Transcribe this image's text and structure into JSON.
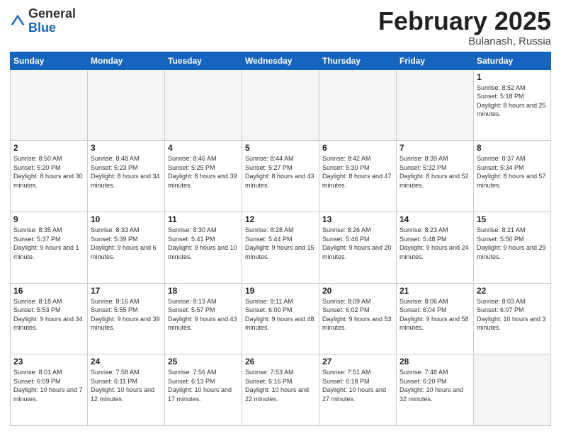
{
  "header": {
    "logo_general": "General",
    "logo_blue": "Blue",
    "title": "February 2025",
    "location": "Bulanash, Russia"
  },
  "days_of_week": [
    "Sunday",
    "Monday",
    "Tuesday",
    "Wednesday",
    "Thursday",
    "Friday",
    "Saturday"
  ],
  "weeks": [
    [
      {
        "day": "",
        "info": ""
      },
      {
        "day": "",
        "info": ""
      },
      {
        "day": "",
        "info": ""
      },
      {
        "day": "",
        "info": ""
      },
      {
        "day": "",
        "info": ""
      },
      {
        "day": "",
        "info": ""
      },
      {
        "day": "1",
        "info": "Sunrise: 8:52 AM\nSunset: 5:18 PM\nDaylight: 8 hours and 25 minutes."
      }
    ],
    [
      {
        "day": "2",
        "info": "Sunrise: 8:50 AM\nSunset: 5:20 PM\nDaylight: 8 hours and 30 minutes."
      },
      {
        "day": "3",
        "info": "Sunrise: 8:48 AM\nSunset: 5:23 PM\nDaylight: 8 hours and 34 minutes."
      },
      {
        "day": "4",
        "info": "Sunrise: 8:46 AM\nSunset: 5:25 PM\nDaylight: 8 hours and 39 minutes."
      },
      {
        "day": "5",
        "info": "Sunrise: 8:44 AM\nSunset: 5:27 PM\nDaylight: 8 hours and 43 minutes."
      },
      {
        "day": "6",
        "info": "Sunrise: 8:42 AM\nSunset: 5:30 PM\nDaylight: 8 hours and 47 minutes."
      },
      {
        "day": "7",
        "info": "Sunrise: 8:39 AM\nSunset: 5:32 PM\nDaylight: 8 hours and 52 minutes."
      },
      {
        "day": "8",
        "info": "Sunrise: 8:37 AM\nSunset: 5:34 PM\nDaylight: 8 hours and 57 minutes."
      }
    ],
    [
      {
        "day": "9",
        "info": "Sunrise: 8:35 AM\nSunset: 5:37 PM\nDaylight: 9 hours and 1 minute."
      },
      {
        "day": "10",
        "info": "Sunrise: 8:33 AM\nSunset: 5:39 PM\nDaylight: 9 hours and 6 minutes."
      },
      {
        "day": "11",
        "info": "Sunrise: 8:30 AM\nSunset: 5:41 PM\nDaylight: 9 hours and 10 minutes."
      },
      {
        "day": "12",
        "info": "Sunrise: 8:28 AM\nSunset: 5:44 PM\nDaylight: 9 hours and 15 minutes."
      },
      {
        "day": "13",
        "info": "Sunrise: 8:26 AM\nSunset: 5:46 PM\nDaylight: 9 hours and 20 minutes."
      },
      {
        "day": "14",
        "info": "Sunrise: 8:23 AM\nSunset: 5:48 PM\nDaylight: 9 hours and 24 minutes."
      },
      {
        "day": "15",
        "info": "Sunrise: 8:21 AM\nSunset: 5:50 PM\nDaylight: 9 hours and 29 minutes."
      }
    ],
    [
      {
        "day": "16",
        "info": "Sunrise: 8:18 AM\nSunset: 5:53 PM\nDaylight: 9 hours and 34 minutes."
      },
      {
        "day": "17",
        "info": "Sunrise: 8:16 AM\nSunset: 5:55 PM\nDaylight: 9 hours and 39 minutes."
      },
      {
        "day": "18",
        "info": "Sunrise: 8:13 AM\nSunset: 5:57 PM\nDaylight: 9 hours and 43 minutes."
      },
      {
        "day": "19",
        "info": "Sunrise: 8:11 AM\nSunset: 6:00 PM\nDaylight: 9 hours and 48 minutes."
      },
      {
        "day": "20",
        "info": "Sunrise: 8:09 AM\nSunset: 6:02 PM\nDaylight: 9 hours and 53 minutes."
      },
      {
        "day": "21",
        "info": "Sunrise: 8:06 AM\nSunset: 6:04 PM\nDaylight: 9 hours and 58 minutes."
      },
      {
        "day": "22",
        "info": "Sunrise: 8:03 AM\nSunset: 6:07 PM\nDaylight: 10 hours and 3 minutes."
      }
    ],
    [
      {
        "day": "23",
        "info": "Sunrise: 8:01 AM\nSunset: 6:09 PM\nDaylight: 10 hours and 7 minutes."
      },
      {
        "day": "24",
        "info": "Sunrise: 7:58 AM\nSunset: 6:11 PM\nDaylight: 10 hours and 12 minutes."
      },
      {
        "day": "25",
        "info": "Sunrise: 7:56 AM\nSunset: 6:13 PM\nDaylight: 10 hours and 17 minutes."
      },
      {
        "day": "26",
        "info": "Sunrise: 7:53 AM\nSunset: 6:16 PM\nDaylight: 10 hours and 22 minutes."
      },
      {
        "day": "27",
        "info": "Sunrise: 7:51 AM\nSunset: 6:18 PM\nDaylight: 10 hours and 27 minutes."
      },
      {
        "day": "28",
        "info": "Sunrise: 7:48 AM\nSunset: 6:20 PM\nDaylight: 10 hours and 32 minutes."
      },
      {
        "day": "",
        "info": ""
      }
    ]
  ]
}
